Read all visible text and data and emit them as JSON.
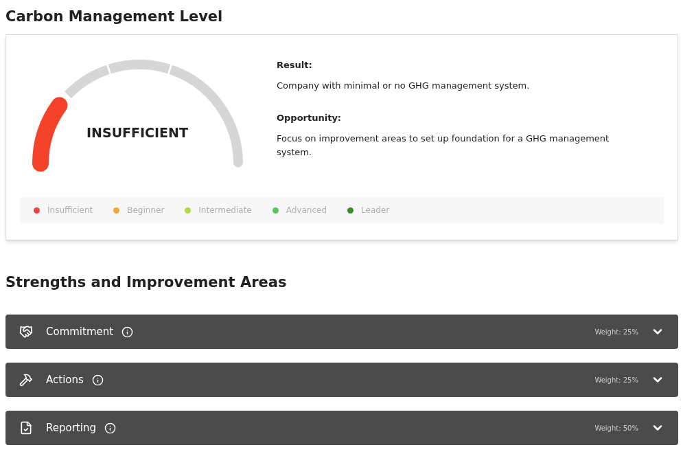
{
  "title": "Carbon Management Level",
  "gauge": {
    "label": "INSUFFICIENT",
    "level": 0.2
  },
  "result": {
    "heading": "Result:",
    "text": "Company with minimal or no GHG management system."
  },
  "opportunity": {
    "heading": "Opportunity:",
    "text": "Focus on improvement areas to set up foundation for a GHG management system."
  },
  "legend": [
    {
      "label": "Insufficient",
      "color": "#e84545"
    },
    {
      "label": "Beginner",
      "color": "#f5a83a"
    },
    {
      "label": "Intermediate",
      "color": "#b5d845"
    },
    {
      "label": "Advanced",
      "color": "#5cc85c"
    },
    {
      "label": "Leader",
      "color": "#3a8e26"
    }
  ],
  "section_title": "Strengths and Improvement Areas",
  "areas": [
    {
      "kind": "commitment",
      "label": "Commitment",
      "weight": "Weight: 25%",
      "expanded": false
    },
    {
      "kind": "actions",
      "label": "Actions",
      "weight": "Weight: 25%",
      "expanded": false
    },
    {
      "kind": "reporting",
      "label": "Reporting",
      "weight": "Weight: 50%",
      "expanded": false
    }
  ]
}
